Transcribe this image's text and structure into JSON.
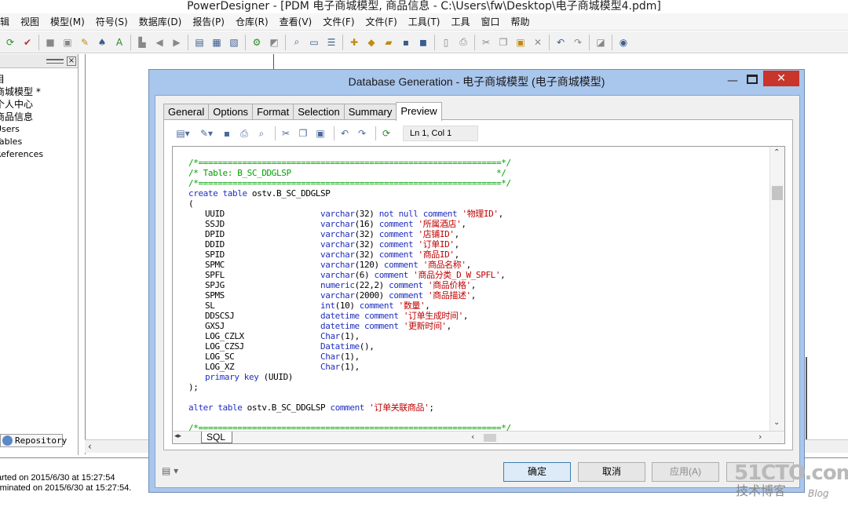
{
  "window_title": "PowerDesigner - [PDM 电子商城模型, 商品信息 - C:\\Users\\fw\\Desktop\\电子商城模型4.pdm]",
  "menu": [
    "编辑",
    "视图",
    "模型(M)",
    "符号(S)",
    "数据库(D)",
    "报告(P)",
    "仓库(R)",
    "查看(V)",
    "文件(F)",
    "文件(F)",
    "工具(T)",
    "工具",
    "窗口",
    "帮助"
  ],
  "left_tree": [
    "目",
    "商城模型 *",
    "个人中心",
    "商品信息",
    "Users",
    "Tables",
    "References"
  ],
  "repository_tab": "Repository",
  "output": {
    "line1": "arted on 2015/6/30 at 15:27:54",
    "line2": "rminated on 2015/6/30 at 15:27:54."
  },
  "dialog": {
    "title": "Database Generation - 电子商城模型 (电子商城模型)",
    "close_glyph": "✕",
    "minimize_glyph": "—",
    "tabs": [
      "General",
      "Options",
      "Format",
      "Selection",
      "Summary",
      "Preview"
    ],
    "active_tab": "Preview",
    "cursor_position": "Ln 1, Col 1",
    "sql_tab": "SQL",
    "buttons": {
      "ok": "确定",
      "cancel": "取消",
      "apply": "应用(A)"
    },
    "code": {
      "c1": "/*==============================================================*/",
      "c2": "/* Table: B_SC_DDGLSP                                          */",
      "c3": "/*==============================================================*/",
      "create_kw": "create table",
      "table_name": " ostv.B_SC_DDGLSP",
      "open_paren": "(",
      "columns": [
        {
          "name": "UUID",
          "type": "varchar",
          "size": "(32)",
          "mod": "not null comment",
          "comment": "'物理ID'",
          "end": ","
        },
        {
          "name": "SSJD",
          "type": "varchar",
          "size": "(16)",
          "mod": "comment",
          "comment": "'所属酒店'",
          "end": ","
        },
        {
          "name": "DPID",
          "type": "varchar",
          "size": "(32)",
          "mod": "comment",
          "comment": "'店铺ID'",
          "end": ","
        },
        {
          "name": "DDID",
          "type": "varchar",
          "size": "(32)",
          "mod": "comment",
          "comment": "'订单ID'",
          "end": ","
        },
        {
          "name": "SPID",
          "type": "varchar",
          "size": "(32)",
          "mod": "comment",
          "comment": "'商品ID'",
          "end": ","
        },
        {
          "name": "SPMC",
          "type": "varchar",
          "size": "(120)",
          "mod": "comment",
          "comment": "'商品名称'",
          "end": ","
        },
        {
          "name": "SPFL",
          "type": "varchar",
          "size": "(6)",
          "mod": "comment",
          "comment": "'商品分类_D_W_SPFL'",
          "end": ","
        },
        {
          "name": "SPJG",
          "type": "numeric",
          "size": "(22,2)",
          "mod": "comment",
          "comment": "'商品价格'",
          "end": ","
        },
        {
          "name": "SPMS",
          "type": "varchar",
          "size": "(2000)",
          "mod": "comment",
          "comment": "'商品描述'",
          "end": ","
        },
        {
          "name": "SL",
          "type": "int",
          "size": "(10)",
          "mod": "comment",
          "comment": "'数量'",
          "end": ","
        },
        {
          "name": "DDSCSJ",
          "type": "datetime",
          "size": "",
          "mod": "comment",
          "comment": "'订单生成时间'",
          "end": ","
        },
        {
          "name": "GXSJ",
          "type": "datetime",
          "size": "",
          "mod": "comment",
          "comment": "'更新时间'",
          "end": ","
        },
        {
          "name": "LOG_CZLX",
          "type": "Char",
          "size": "(1)",
          "mod": "",
          "comment": "",
          "end": ","
        },
        {
          "name": "LOG_CZSJ",
          "type": "Datatime",
          "size": "()",
          "mod": "",
          "comment": "",
          "end": ","
        },
        {
          "name": "LOG_SC",
          "type": "Char",
          "size": "(1)",
          "mod": "",
          "comment": "",
          "end": ","
        },
        {
          "name": "LOG_XZ",
          "type": "Char",
          "size": "(1)",
          "mod": "",
          "comment": "",
          "end": ","
        }
      ],
      "pk_kw": "primary key",
      "pk_cols": " (UUID)",
      "close_paren": ");",
      "alter_kw": "alter table",
      "alter_name": " ostv.B_SC_DDGLSP ",
      "alter_comment_kw": "comment",
      "alter_comment": " '订单关联商品'",
      "alter_end": ";",
      "c4": "/*==============================================================*/"
    }
  },
  "watermark": {
    "line1": "51CTO.com",
    "line2": "技术博客",
    "line3": "Blog"
  }
}
